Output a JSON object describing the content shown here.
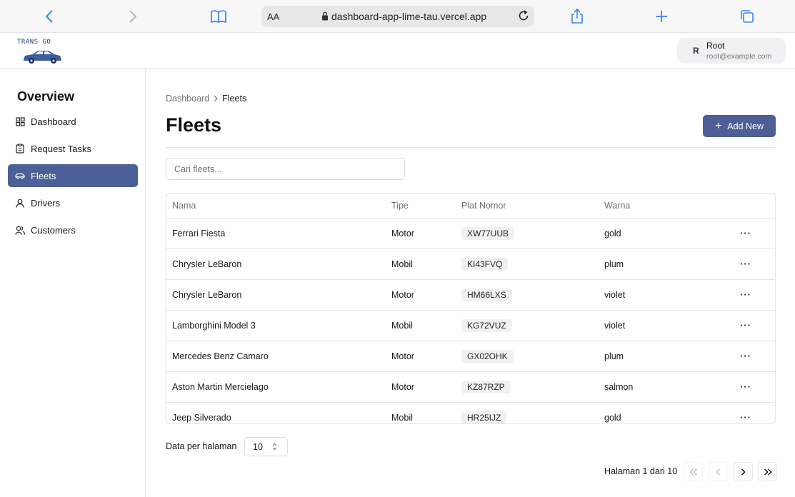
{
  "browser": {
    "aa_label": "AA",
    "url": "dashboard-app-lime-tau.vercel.app"
  },
  "brand": {
    "logo_text": "TRANS GO"
  },
  "user": {
    "initial": "R",
    "name": "Root",
    "email": "root@example.com"
  },
  "sidebar": {
    "title": "Overview",
    "items": [
      {
        "label": "Dashboard",
        "icon": "grid-icon",
        "active": false
      },
      {
        "label": "Request Tasks",
        "icon": "clipboard-icon",
        "active": false
      },
      {
        "label": "Fleets",
        "icon": "car-icon",
        "active": true
      },
      {
        "label": "Drivers",
        "icon": "user-icon",
        "active": false
      },
      {
        "label": "Customers",
        "icon": "users-icon",
        "active": false
      }
    ]
  },
  "breadcrumb": {
    "parent": "Dashboard",
    "current": "Fleets"
  },
  "page": {
    "title": "Fleets",
    "add_label": "Add New"
  },
  "search": {
    "placeholder": "Cari fleets...",
    "value": ""
  },
  "table": {
    "headers": [
      "Nama",
      "Tipe",
      "Plat Nomor",
      "Warna"
    ],
    "rows": [
      {
        "nama": "Ferrari Fiesta",
        "tipe": "Motor",
        "plat": "XW77UUB",
        "warna": "gold"
      },
      {
        "nama": "Chrysler LeBaron",
        "tipe": "Mobil",
        "plat": "KI43FVQ",
        "warna": "plum"
      },
      {
        "nama": "Chrysler LeBaron",
        "tipe": "Motor",
        "plat": "HM66LXS",
        "warna": "violet"
      },
      {
        "nama": "Lamborghini Model 3",
        "tipe": "Mobil",
        "plat": "KG72VUZ",
        "warna": "violet"
      },
      {
        "nama": "Mercedes Benz Camaro",
        "tipe": "Motor",
        "plat": "GX02OHK",
        "warna": "plum"
      },
      {
        "nama": "Aston Martin Mercielago",
        "tipe": "Motor",
        "plat": "KZ87RZP",
        "warna": "salmon"
      },
      {
        "nama": "Jeep Silverado",
        "tipe": "Mobil",
        "plat": "HR25IJZ",
        "warna": "gold"
      }
    ],
    "row_action_label": "···"
  },
  "pagination": {
    "per_page_label": "Data per halaman",
    "per_page_value": "10",
    "page_info": "Halaman 1 dari 10"
  },
  "colors": {
    "accent": "#4c5f96",
    "browser_blue": "#3b82f6"
  }
}
